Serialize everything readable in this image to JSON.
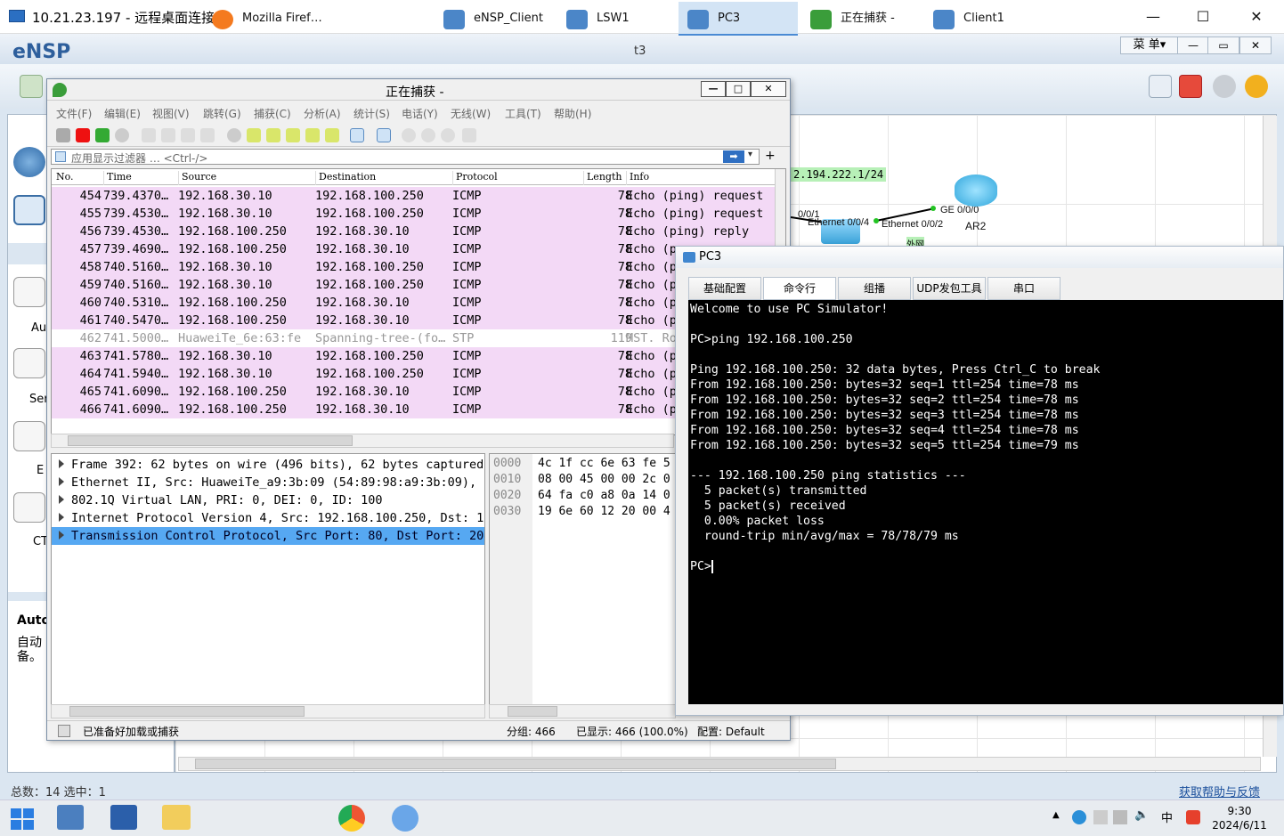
{
  "rdp": {
    "title": "10.21.23.197 - 远程桌面连接",
    "min": "—",
    "max": "☐",
    "close": "✕"
  },
  "ensp": {
    "logo": "eNSP",
    "title": "t3",
    "menu": "菜 单▾",
    "min": "—",
    "restore": "▭",
    "close": "✕",
    "left_labels": [
      "Au",
      "Ser",
      "E",
      "CT"
    ],
    "auto_title": "Auto",
    "auto_desc_1": "自动",
    "auto_desc_2": "备。",
    "status_left": "总数：14 选中：1",
    "status_help": "获取帮助与反馈"
  },
  "topology": {
    "net_label": "2.194.222.1/24",
    "ports": {
      "e001": "0/0/1",
      "e004": "Ethernet 0/0/4",
      "e002": "Ethernet 0/0/2",
      "ge000": "GE 0/0/0"
    },
    "ar2": "AR2",
    "small": "外网"
  },
  "wireshark": {
    "title": "正在捕获 -",
    "menu": [
      "文件(F)",
      "编辑(E)",
      "视图(V)",
      "跳转(G)",
      "捕获(C)",
      "分析(A)",
      "统计(S)",
      "电话(Y)",
      "无线(W)",
      "工具(T)",
      "帮助(H)"
    ],
    "filter_placeholder": "应用显示过滤器 … <Ctrl-/>",
    "columns": [
      "No.",
      "Time",
      "Source",
      "Destination",
      "Protocol",
      "Length",
      "Info"
    ],
    "packets": [
      {
        "no": "454",
        "time": "739.4370…",
        "src": "192.168.30.10",
        "dst": "192.168.100.250",
        "proto": "ICMP",
        "len": "78",
        "info": "Echo (ping) request"
      },
      {
        "no": "455",
        "time": "739.4530…",
        "src": "192.168.30.10",
        "dst": "192.168.100.250",
        "proto": "ICMP",
        "len": "78",
        "info": "Echo (ping) request"
      },
      {
        "no": "456",
        "time": "739.4530…",
        "src": "192.168.100.250",
        "dst": "192.168.30.10",
        "proto": "ICMP",
        "len": "78",
        "info": "Echo (ping) reply"
      },
      {
        "no": "457",
        "time": "739.4690…",
        "src": "192.168.100.250",
        "dst": "192.168.30.10",
        "proto": "ICMP",
        "len": "78",
        "info": "Echo (p"
      },
      {
        "no": "458",
        "time": "740.5160…",
        "src": "192.168.30.10",
        "dst": "192.168.100.250",
        "proto": "ICMP",
        "len": "78",
        "info": "Echo (p"
      },
      {
        "no": "459",
        "time": "740.5160…",
        "src": "192.168.30.10",
        "dst": "192.168.100.250",
        "proto": "ICMP",
        "len": "78",
        "info": "Echo (p"
      },
      {
        "no": "460",
        "time": "740.5310…",
        "src": "192.168.100.250",
        "dst": "192.168.30.10",
        "proto": "ICMP",
        "len": "78",
        "info": "Echo (p"
      },
      {
        "no": "461",
        "time": "740.5470…",
        "src": "192.168.100.250",
        "dst": "192.168.30.10",
        "proto": "ICMP",
        "len": "78",
        "info": "Echo (p"
      },
      {
        "no": "462",
        "time": "741.5000…",
        "src": "HuaweiTe_6e:63:fe",
        "dst": "Spanning-tree-(fo…",
        "proto": "STP",
        "len": "119",
        "info": "MST. Ro"
      },
      {
        "no": "463",
        "time": "741.5780…",
        "src": "192.168.30.10",
        "dst": "192.168.100.250",
        "proto": "ICMP",
        "len": "78",
        "info": "Echo (p"
      },
      {
        "no": "464",
        "time": "741.5940…",
        "src": "192.168.30.10",
        "dst": "192.168.100.250",
        "proto": "ICMP",
        "len": "78",
        "info": "Echo (p"
      },
      {
        "no": "465",
        "time": "741.6090…",
        "src": "192.168.100.250",
        "dst": "192.168.30.10",
        "proto": "ICMP",
        "len": "78",
        "info": "Echo (p"
      },
      {
        "no": "466",
        "time": "741.6090…",
        "src": "192.168.100.250",
        "dst": "192.168.30.10",
        "proto": "ICMP",
        "len": "78",
        "info": "Echo (p"
      }
    ],
    "details": [
      "Frame 392: 62 bytes on wire (496 bits), 62 bytes captured",
      "Ethernet II, Src: HuaweiTe_a9:3b:09 (54:89:98:a9:3b:09), D",
      "802.1Q Virtual LAN, PRI: 0, DEI: 0, ID: 100",
      "Internet Protocol Version 4, Src: 192.168.100.250, Dst: 19",
      "Transmission Control Protocol, Src Port: 80, Dst Port: 204"
    ],
    "hex": [
      {
        "off": "0000",
        "bytes": "4c 1f cc 6e 63 fe 5"
      },
      {
        "off": "0010",
        "bytes": "08 00 45 00 00 2c 0"
      },
      {
        "off": "0020",
        "bytes": "64 fa c0 a8 0a 14 0"
      },
      {
        "off": "0030",
        "bytes": "19 6e 60 12 20 00 4"
      }
    ],
    "status_ready": "已准备好加载或捕获",
    "status_pkts": "分组: 466",
    "status_shown": "已显示: 466 (100.0%)",
    "status_profile": "配置: Default"
  },
  "pc3": {
    "title": "PC3",
    "tabs": [
      "基础配置",
      "命令行",
      "组播",
      "UDP发包工具",
      "串口"
    ],
    "terminal": [
      "Welcome to use PC Simulator!",
      "",
      "PC>ping 192.168.100.250",
      "",
      "Ping 192.168.100.250: 32 data bytes, Press Ctrl_C to break",
      "From 192.168.100.250: bytes=32 seq=1 ttl=254 time=78 ms",
      "From 192.168.100.250: bytes=32 seq=2 ttl=254 time=78 ms",
      "From 192.168.100.250: bytes=32 seq=3 ttl=254 time=78 ms",
      "From 192.168.100.250: bytes=32 seq=4 ttl=254 time=78 ms",
      "From 192.168.100.250: bytes=32 seq=5 ttl=254 time=79 ms",
      "",
      "--- 192.168.100.250 ping statistics ---",
      "  5 packet(s) transmitted",
      "  5 packet(s) received",
      "  0.00% packet loss",
      "  round-trip min/avg/max = 78/78/79 ms",
      ""
    ],
    "prompt": "PC>"
  },
  "taskbar": {
    "items": [
      "Mozilla Firef…",
      "eNSP_Client",
      "LSW1",
      "PC3",
      "正在捕获 -",
      "Client1"
    ],
    "time": "9:30",
    "date": "2024/6/11",
    "ime": "中"
  }
}
